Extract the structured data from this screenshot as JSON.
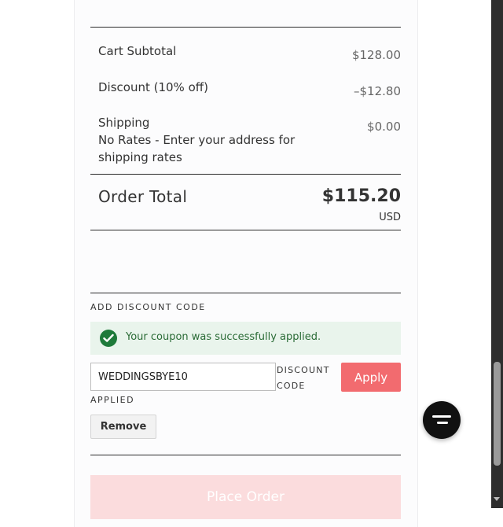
{
  "summary": {
    "subtotal_label": "Cart Subtotal",
    "subtotal_value": "$128.00",
    "discount_label": "Discount (10% off)",
    "discount_value": "–$12.80",
    "shipping_label": "Shipping",
    "shipping_value": "$0.00",
    "shipping_note": "No Rates - Enter your address for shipping rates",
    "total_label": "Order Total",
    "total_value": "$115.20",
    "total_currency": "USD"
  },
  "discount": {
    "section_title": "ADD DISCOUNT CODE",
    "success_message": "Your coupon was successfully applied.",
    "code_value": "WEDDINGSBYE10",
    "code_label": "DISCOUNT CODE",
    "apply_label": "Apply",
    "applied_label": "APPLIED",
    "remove_label": "Remove"
  },
  "place_order_label": "Place Order",
  "icons": {
    "success": "check-circle-icon",
    "chat": "chat-icon"
  },
  "colors": {
    "apply_button": "#f26b6f",
    "place_order_button": "#fbdcdd",
    "success_bg": "#e9f4ec",
    "success_icon": "#1e7a3a"
  }
}
